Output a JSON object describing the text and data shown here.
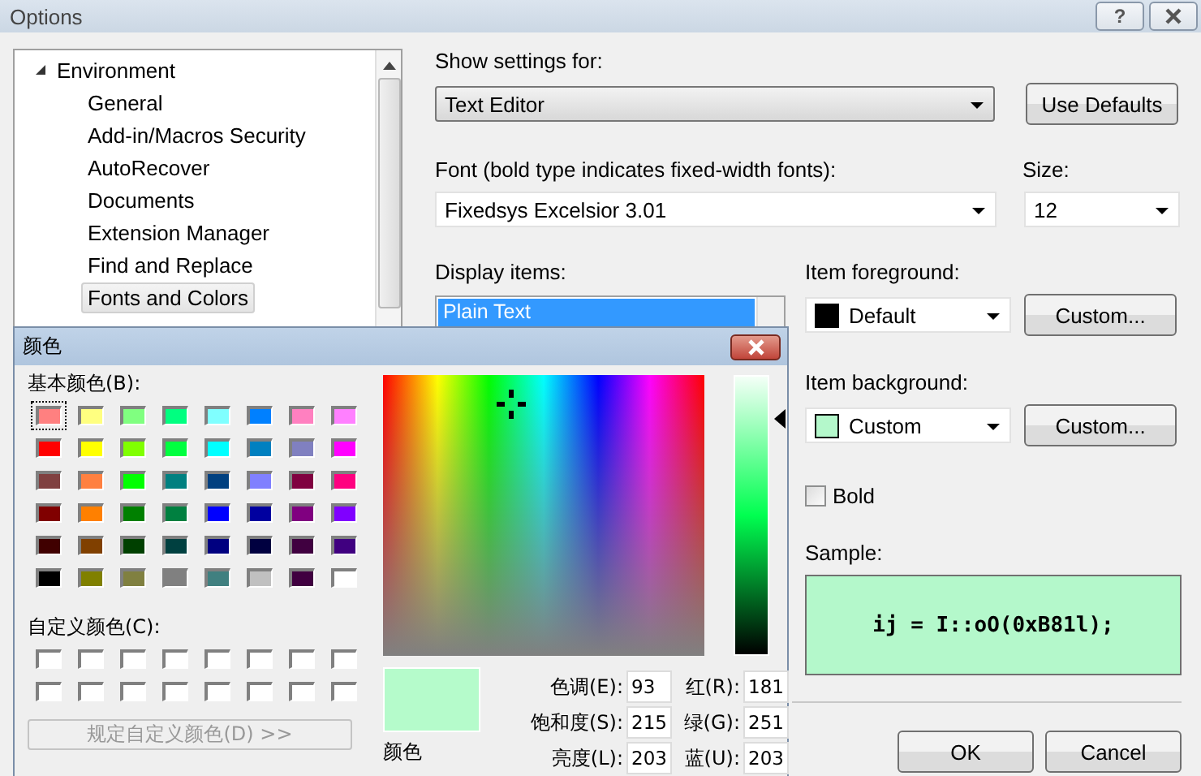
{
  "window": {
    "title": "Options",
    "help_label": "?"
  },
  "tree": {
    "items": [
      {
        "label": "Environment",
        "expanded": true,
        "children": [
          {
            "label": "General",
            "selected": false
          },
          {
            "label": "Add-in/Macros Security",
            "selected": false
          },
          {
            "label": "AutoRecover",
            "selected": false
          },
          {
            "label": "Documents",
            "selected": false
          },
          {
            "label": "Extension Manager",
            "selected": false
          },
          {
            "label": "Find and Replace",
            "selected": false
          },
          {
            "label": "Fonts and Colors",
            "selected": true
          }
        ]
      }
    ]
  },
  "settings": {
    "show_for_label": "Show settings for:",
    "show_for_value": "Text Editor",
    "use_defaults": "Use Defaults",
    "font_label": "Font (bold type indicates fixed-width fonts):",
    "font_value": "Fixedsys Excelsior 3.01",
    "size_label": "Size:",
    "size_value": "12",
    "display_items_label": "Display items:",
    "display_items": [
      {
        "label": "Plain Text",
        "selected": true
      }
    ],
    "foreground_label": "Item foreground:",
    "foreground": {
      "value": "Default",
      "color": "#000000"
    },
    "background_label": "Item background:",
    "background": {
      "value": "Custom",
      "color": "#b4f8cb"
    },
    "foreground_custom_button": "Custom...",
    "background_custom_button": "Custom...",
    "bold": {
      "label": "Bold",
      "checked": false
    },
    "sample_label": "Sample:",
    "sample_text": "ij = I::oO(0xB81l);",
    "ok": "OK",
    "cancel": "Cancel"
  },
  "color_dialog": {
    "title": "颜色",
    "basic_label": "基本颜色(B):",
    "basic_colors": [
      {
        "color": "#ff8080",
        "selected": true
      },
      {
        "color": "#ffff80",
        "selected": false
      },
      {
        "color": "#80ff80",
        "selected": false
      },
      {
        "color": "#00ff80",
        "selected": false
      },
      {
        "color": "#80ffff",
        "selected": false
      },
      {
        "color": "#0080ff",
        "selected": false
      },
      {
        "color": "#ff80c0",
        "selected": false
      },
      {
        "color": "#ff80ff",
        "selected": false
      },
      {
        "color": "#ff0000",
        "selected": false
      },
      {
        "color": "#ffff00",
        "selected": false
      },
      {
        "color": "#80ff00",
        "selected": false
      },
      {
        "color": "#00ff40",
        "selected": false
      },
      {
        "color": "#00ffff",
        "selected": false
      },
      {
        "color": "#0080c0",
        "selected": false
      },
      {
        "color": "#8080c0",
        "selected": false
      },
      {
        "color": "#ff00ff",
        "selected": false
      },
      {
        "color": "#804040",
        "selected": false
      },
      {
        "color": "#ff8040",
        "selected": false
      },
      {
        "color": "#00ff00",
        "selected": false
      },
      {
        "color": "#008080",
        "selected": false
      },
      {
        "color": "#004080",
        "selected": false
      },
      {
        "color": "#8080ff",
        "selected": false
      },
      {
        "color": "#800040",
        "selected": false
      },
      {
        "color": "#ff0080",
        "selected": false
      },
      {
        "color": "#800000",
        "selected": false
      },
      {
        "color": "#ff8000",
        "selected": false
      },
      {
        "color": "#008000",
        "selected": false
      },
      {
        "color": "#008040",
        "selected": false
      },
      {
        "color": "#0000ff",
        "selected": false
      },
      {
        "color": "#0000a0",
        "selected": false
      },
      {
        "color": "#800080",
        "selected": false
      },
      {
        "color": "#8000ff",
        "selected": false
      },
      {
        "color": "#400000",
        "selected": false
      },
      {
        "color": "#804000",
        "selected": false
      },
      {
        "color": "#004000",
        "selected": false
      },
      {
        "color": "#004040",
        "selected": false
      },
      {
        "color": "#000080",
        "selected": false
      },
      {
        "color": "#000040",
        "selected": false
      },
      {
        "color": "#400040",
        "selected": false
      },
      {
        "color": "#400080",
        "selected": false
      },
      {
        "color": "#000000",
        "selected": false
      },
      {
        "color": "#808000",
        "selected": false
      },
      {
        "color": "#808040",
        "selected": false
      },
      {
        "color": "#808080",
        "selected": false
      },
      {
        "color": "#408080",
        "selected": false
      },
      {
        "color": "#c0c0c0",
        "selected": false
      },
      {
        "color": "#400040",
        "selected": false
      },
      {
        "color": "#ffffff",
        "selected": false
      }
    ],
    "custom_label": "自定义颜色(C):",
    "custom_colors": [
      {
        "color": "#ffffff"
      },
      {
        "color": "#ffffff"
      },
      {
        "color": "#ffffff"
      },
      {
        "color": "#ffffff"
      },
      {
        "color": "#ffffff"
      },
      {
        "color": "#ffffff"
      },
      {
        "color": "#ffffff"
      },
      {
        "color": "#ffffff"
      },
      {
        "color": "#ffffff"
      },
      {
        "color": "#ffffff"
      },
      {
        "color": "#ffffff"
      },
      {
        "color": "#ffffff"
      },
      {
        "color": "#ffffff"
      },
      {
        "color": "#ffffff"
      },
      {
        "color": "#ffffff"
      },
      {
        "color": "#ffffff"
      }
    ],
    "define_button": {
      "label": "规定自定义颜色(D) >>",
      "disabled": true
    },
    "luminance": {
      "level": 0.85
    },
    "preview": {
      "color": "#b5fbcb",
      "label": "颜色"
    },
    "fields": [
      {
        "label": "色调(E):",
        "value": "93"
      },
      {
        "label": "红(R):",
        "value": "181"
      },
      {
        "label": "饱和度(S):",
        "value": "215"
      },
      {
        "label": "绿(G):",
        "value": "251"
      },
      {
        "label": "亮度(L):",
        "value": "203"
      },
      {
        "label": "蓝(U):",
        "value": "203"
      }
    ]
  }
}
